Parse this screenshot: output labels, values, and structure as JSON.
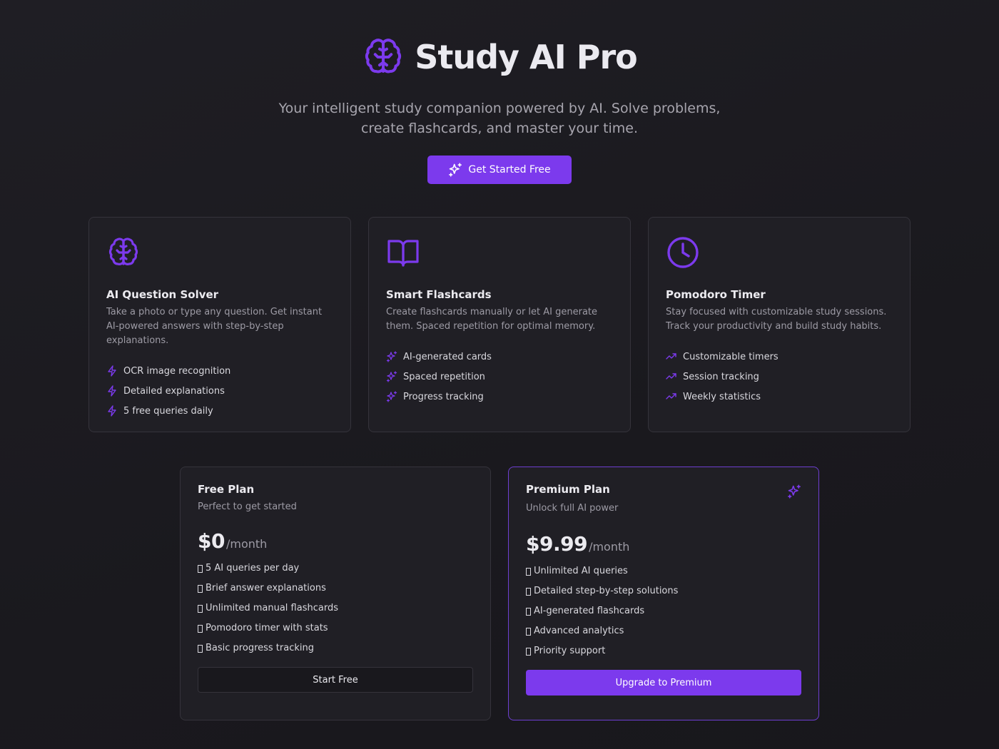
{
  "colors": {
    "accent": "#7c3aed",
    "background": "#1b1a1f",
    "card": "#201f25"
  },
  "hero": {
    "title": "Study AI Pro",
    "logo_icon": "brain-icon",
    "tagline": "Your intelligent study companion powered by AI. Solve problems, create flashcards, and master your time.",
    "cta_label": "Get Started Free",
    "cta_icon": "sparkles-icon"
  },
  "features": [
    {
      "icon": "brain-icon",
      "title": "AI Question Solver",
      "description": "Take a photo or type any question. Get instant AI-powered answers with step-by-step explanations.",
      "bullet_icon": "lightning-icon",
      "items": [
        "OCR image recognition",
        "Detailed explanations",
        "5 free queries daily"
      ]
    },
    {
      "icon": "book-open-icon",
      "title": "Smart Flashcards",
      "description": "Create flashcards manually or let AI generate them. Spaced repetition for optimal memory.",
      "bullet_icon": "sparkles-icon",
      "items": [
        "AI-generated cards",
        "Spaced repetition",
        "Progress tracking"
      ]
    },
    {
      "icon": "clock-icon",
      "title": "Pomodoro Timer",
      "description": "Stay focused with customizable study sessions. Track your productivity and build study habits.",
      "bullet_icon": "trending-up-icon",
      "items": [
        "Customizable timers",
        "Session tracking",
        "Weekly statistics"
      ]
    }
  ],
  "plans": {
    "free": {
      "title": "Free Plan",
      "subtitle": "Perfect to get started",
      "price": "$0",
      "period": "/month",
      "items": [
        "5 AI queries per day",
        "Brief answer explanations",
        "Unlimited manual flashcards",
        "Pomodoro timer with stats",
        "Basic progress tracking"
      ],
      "button_label": "Start Free"
    },
    "premium": {
      "title": "Premium Plan",
      "subtitle": "Unlock full AI power",
      "price": "$9.99",
      "period": "/month",
      "items": [
        "Unlimited AI queries",
        "Detailed step-by-step solutions",
        "AI-generated flashcards",
        "Advanced analytics",
        "Priority support"
      ],
      "button_label": "Upgrade to Premium",
      "corner_icon": "sparkles-icon"
    }
  }
}
